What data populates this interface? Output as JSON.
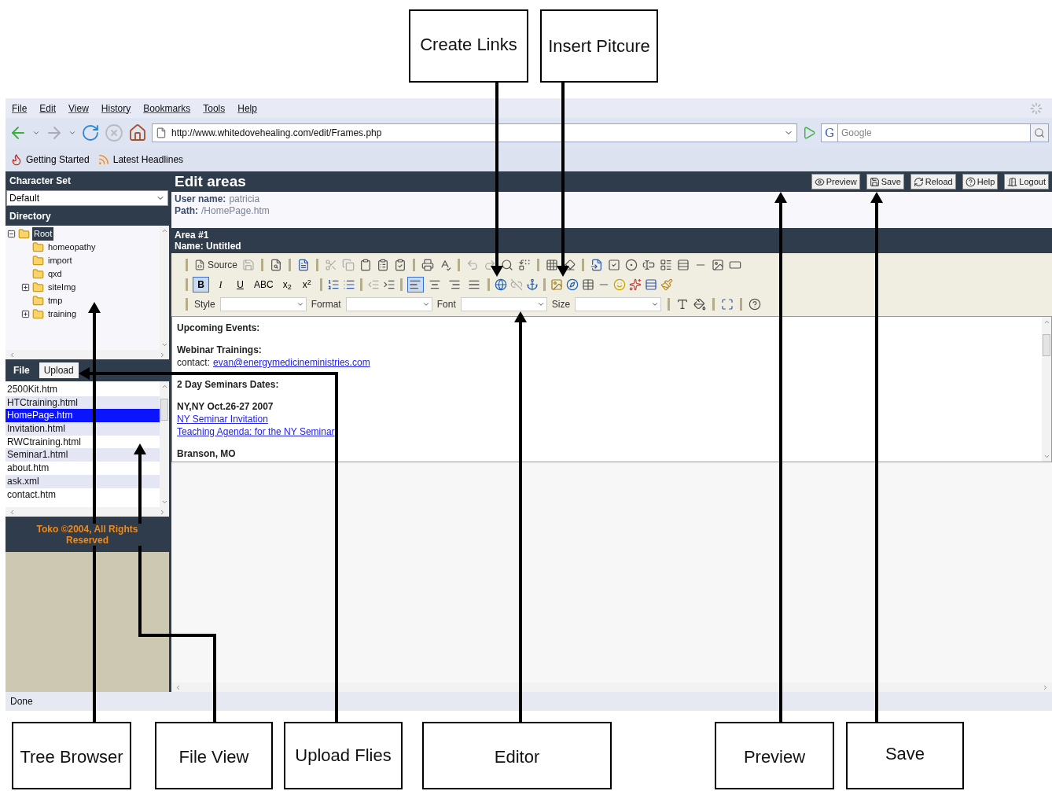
{
  "callouts": [
    {
      "text": "Create Links"
    },
    {
      "text": "Insert Pitcure"
    },
    {
      "text": "Tree Browser"
    },
    {
      "text": "File View"
    },
    {
      "text": "Upload Flies"
    },
    {
      "text": "Editor"
    },
    {
      "text": "Preview"
    },
    {
      "text": "Save"
    }
  ],
  "browser": {
    "menu": [
      "File",
      "Edit",
      "View",
      "History",
      "Bookmarks",
      "Tools",
      "Help"
    ],
    "url": "http://www.whitedovehealing.com/edit/Frames.php",
    "search_engine": "G",
    "search_placeholder": "Google",
    "bookmarks": [
      "Getting Started",
      "Latest Headlines"
    ],
    "status": "Done"
  },
  "sidebar": {
    "charset_title": "Character Set",
    "charset_value": "Default",
    "directory_title": "Directory",
    "tree": [
      {
        "label": "Root",
        "selected": true,
        "expanded": true,
        "children": [
          {
            "label": "homeopathy",
            "selected": false
          },
          {
            "label": "import",
            "selected": false
          },
          {
            "label": "qxd",
            "selected": false
          },
          {
            "label": "siteImg",
            "selected": false,
            "expanded": false
          },
          {
            "label": "tmp",
            "selected": false
          },
          {
            "label": "training",
            "selected": false,
            "expanded": false
          }
        ]
      }
    ],
    "file_tabs": [
      {
        "label": "File",
        "selected": true
      },
      {
        "label": "Upload",
        "selected": false
      }
    ],
    "files": [
      {
        "name": "2500Kit.htm",
        "selected": false
      },
      {
        "name": "HTCtraining.html",
        "selected": false
      },
      {
        "name": "HomePage.htm",
        "selected": true
      },
      {
        "name": "Invitation.html",
        "selected": false
      },
      {
        "name": "RWCtraining.html",
        "selected": false
      },
      {
        "name": "Seminar1.html",
        "selected": false
      },
      {
        "name": "about.htm",
        "selected": false
      },
      {
        "name": "ask.xml",
        "selected": false
      },
      {
        "name": "contact.htm",
        "selected": false
      }
    ],
    "footer": "Toko ©2004, All Rights Reserved"
  },
  "editor": {
    "title": "Edit areas",
    "buttons": [
      "Preview",
      "Save",
      "Reload",
      "Help",
      "Logout"
    ],
    "user_label": "User name:",
    "user": "patricia",
    "path_label": "Path:",
    "path": "/HomePage.htm",
    "area_number": "Area #1",
    "area_name": "Name: Untitled",
    "source_label": "Source",
    "format_buttons": [
      {
        "label": "B",
        "selected": true
      },
      {
        "label": "I",
        "selected": false
      },
      {
        "label": "U",
        "selected": false
      },
      {
        "label": "ABC",
        "selected": false
      },
      {
        "label": "x$_{2}$",
        "selected": false
      },
      {
        "label": "x$^{2}$",
        "selected": false
      }
    ],
    "alignment": [
      {
        "selected": true
      },
      {
        "selected": false
      },
      {
        "selected": false
      },
      {
        "selected": false
      }
    ],
    "dropdowns": [
      {
        "label": "Style"
      },
      {
        "label": "Format"
      },
      {
        "label": "Font"
      },
      {
        "label": "Size"
      }
    ],
    "content": [
      {
        "lines": [
          {
            "kind": "heading",
            "text": "Upcoming Events:"
          }
        ]
      },
      {
        "lines": [
          {
            "kind": "heading",
            "text": "Webinar Trainings:"
          },
          {
            "kind": "contact",
            "label": "contact:",
            "link": "evan@energymedicineministries.com"
          }
        ]
      },
      {
        "lines": [
          {
            "kind": "heading",
            "text": "2 Day Seminars Dates:"
          }
        ]
      },
      {
        "lines": [
          {
            "kind": "heading",
            "text": "NY,NY Oct.26-27 2007"
          },
          {
            "kind": "link",
            "text": "NY Seminar Invitation"
          },
          {
            "kind": "link",
            "text": "Teaching Agenda: for the NY Seminar"
          }
        ]
      },
      {
        "lines": [
          {
            "kind": "heading",
            "text": "Branson, MO"
          }
        ]
      }
    ]
  }
}
